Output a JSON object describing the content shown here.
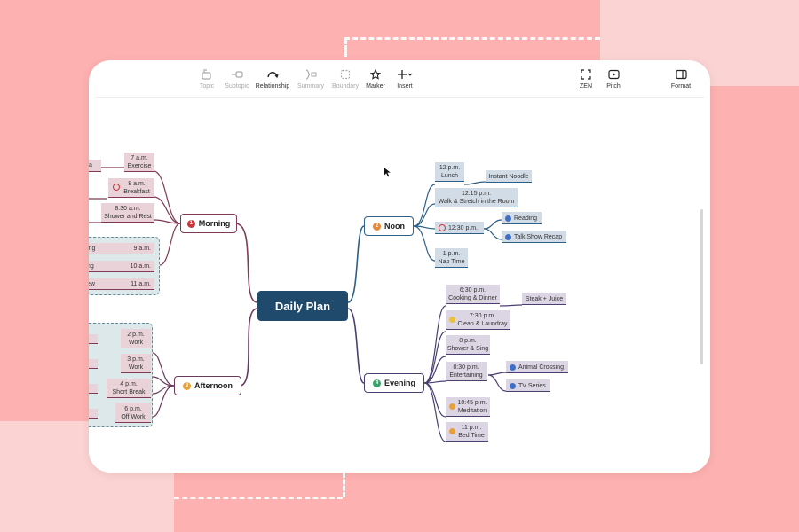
{
  "colors": {
    "background": "#fdb1b0",
    "central_fill": "#1f4a6b",
    "morning": "#7e3a57",
    "noon": "#2e5f87",
    "evening": "#4b3f72",
    "afternoon": "#6a3a5a"
  },
  "toolbar": {
    "topic": "Topic",
    "subtopic": "Subtopic",
    "relationship": "Relationship",
    "summary": "Summary",
    "boundary": "Boundary",
    "marker": "Marker",
    "insert": "Insert",
    "zen": "ZEN",
    "pitch": "Pitch",
    "format": "Format"
  },
  "central": "Daily Plan",
  "morning": {
    "label": "Morning",
    "number": "1",
    "items": [
      {
        "time": "7 a.m.",
        "task": "Exercise"
      },
      {
        "time": "8 a.m.",
        "task": "Breakfast"
      },
      {
        "time": "8:30 a.m.",
        "task": "Shower and Rest"
      },
      {
        "time": "9 a.m.",
        "left": "ing"
      },
      {
        "time": "10 a.m.",
        "left": "ng"
      },
      {
        "time": "11 a.m.",
        "left": "ew"
      }
    ],
    "fragment_top": "a"
  },
  "afternoon": {
    "label": "Afternoon",
    "number": "3",
    "items": [
      {
        "time": "2 p.m.",
        "task": "Work"
      },
      {
        "time": "3 p.m.",
        "task": "Work"
      },
      {
        "time": "4 p.m.",
        "task": "Short Break"
      },
      {
        "time": "6 p.m.",
        "task": "Off Work"
      }
    ]
  },
  "noon": {
    "label": "Noon",
    "number": "2",
    "items": [
      {
        "time": "12 p.m.",
        "task": "Lunch",
        "child": "Instant Noodle"
      },
      {
        "time": "12:15 p.m.",
        "task": "Walk & Stretch in the Room"
      },
      {
        "time": "12:30 p.m.",
        "children": [
          "Reading",
          "Talk Show Recap"
        ]
      },
      {
        "time": "1 p.m.",
        "task": "Nap Time"
      }
    ]
  },
  "evening": {
    "label": "Evening",
    "number": "4",
    "items": [
      {
        "time": "6:30 p.m.",
        "task": "Cooking & Dinner",
        "child": "Steak + Juice"
      },
      {
        "time": "7:30 p.m.",
        "task": "Clean & Laundray"
      },
      {
        "time": "8 p.m.",
        "task": "Shower & Sing"
      },
      {
        "time": "8:30 p.m.",
        "task": "Entertaining",
        "children": [
          "Animal Crossing",
          "TV Series"
        ]
      },
      {
        "time": "10:45 p.m.",
        "task": "Meditation"
      },
      {
        "time": "11 p.m.",
        "task": "Bed Time"
      }
    ]
  }
}
